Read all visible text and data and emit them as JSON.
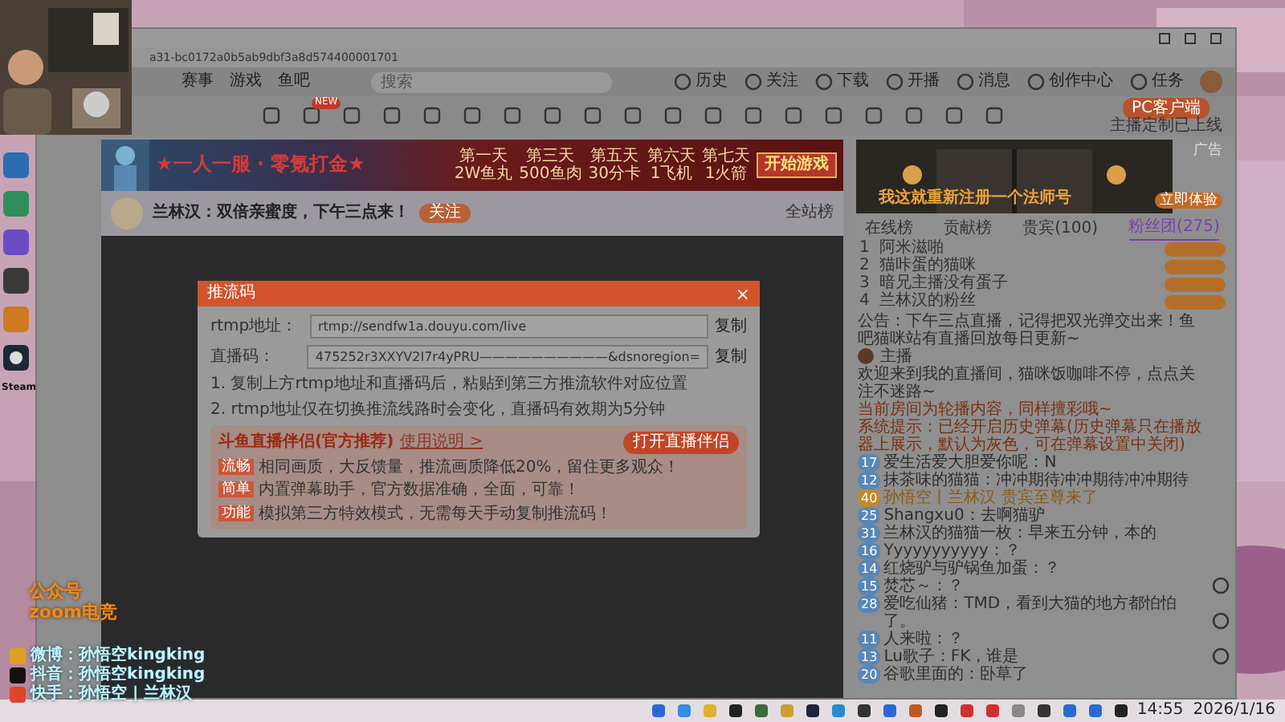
{
  "desktop_icons": [
    {
      "label": "Steam"
    }
  ],
  "browser": {
    "url": "a31-bc0172a0b5ab9dbf3a8d574400001701",
    "nav": [
      "赛事",
      "游戏",
      "鱼吧"
    ],
    "search": {
      "placeholder": "搜索"
    },
    "header_items": [
      {
        "label": "历史"
      },
      {
        "label": "关注"
      },
      {
        "label": "下载"
      },
      {
        "label": "开播"
      },
      {
        "label": "消息"
      },
      {
        "label": "创作中心"
      },
      {
        "label": "任务"
      }
    ],
    "tool_badge": "NEW",
    "pc_client": {
      "label": "PC客户端",
      "note": "主播定制已上线"
    }
  },
  "banner": {
    "slogan": "★一人一服 · 零氪打金★",
    "days": [
      {
        "day": "第一天",
        "reward": "2W鱼丸"
      },
      {
        "day": "第三天",
        "reward": "500鱼肉"
      },
      {
        "day": "第五天",
        "reward": "30分卡"
      },
      {
        "day": "第六天",
        "reward": "1飞机"
      },
      {
        "day": "第七天",
        "reward": "1火箭"
      }
    ],
    "button": "开始游戏"
  },
  "streamer": {
    "title": "兰林汉：双倍亲蜜度，下午三点来！",
    "follow": "关注",
    "rank": "全站榜"
  },
  "modal": {
    "title": "推流码",
    "close": "×",
    "fields": [
      {
        "label": "rtmp地址：",
        "value": "rtmp://sendfw1a.douyu.com/live",
        "copy": "复制"
      },
      {
        "label": "直播码：",
        "value": "475252r3XXYV2I7r4yPRU——————————&dsnoregion=",
        "copy": "复制"
      }
    ],
    "notes": [
      "1. 复制上方rtmp地址和直播码后，粘贴到第三方推流软件对应位置",
      "2. rtmp地址仅在切换推流线路时会变化，直播码有效期为5分钟"
    ],
    "promo": {
      "title": "斗鱼直播伴侣(官方推荐)",
      "link": "使用说明 >",
      "button": "打开直播伴侣",
      "lines": [
        {
          "tag": "流畅",
          "text": "相同画质，大反馈量，推流画质降低20%，留住更多观众！"
        },
        {
          "tag": "简单",
          "text": "内置弹幕助手，官方数据准确，全面，可靠！"
        },
        {
          "tag": "功能",
          "text": "模拟第三方特效模式，无需每天手动复制推流码！"
        }
      ]
    }
  },
  "sidebar": {
    "ad": {
      "label": "广告",
      "caption": "我这就重新注册一个法师号",
      "button": "立即体验"
    },
    "tabs": [
      {
        "label": "在线榜",
        "selected": false
      },
      {
        "label": "贡献榜",
        "selected": false
      },
      {
        "label": "贵宾(100)",
        "selected": false
      },
      {
        "label": "粉丝团(275)",
        "selected": true
      }
    ],
    "ranks": [
      {
        "rank": "1",
        "name": "阿米滋啪"
      },
      {
        "rank": "2",
        "name": "猫咔蛋的猫咪"
      },
      {
        "rank": "3",
        "name": "暗兄主播没有蛋子"
      },
      {
        "rank": "4",
        "name": "兰林汉的粉丝"
      }
    ],
    "notice": "公告：下午三点直播，记得把双光弹交出来！鱼吧猫咪站有直播回放每日更新~",
    "host": {
      "name": "主播",
      "text": "欢迎来到我的直播间，猫咪饭咖啡不停，点点关注不迷路~"
    },
    "chat": [
      {
        "kind": "system",
        "text": "当前房间为轮播内容，同样擅彩哦~"
      },
      {
        "kind": "system",
        "text": "系统提示：已经开启历史弹幕(历史弹幕只在播放器上展示，默认为灰色，可在弹幕设置中关闭)"
      },
      {
        "kind": "message",
        "level": "17",
        "text": "爱生活爱大胆爱你呢：N"
      },
      {
        "kind": "message",
        "level": "12",
        "text": "抹茶味的猫猫：冲冲期待冲冲期待冲冲期待"
      },
      {
        "kind": "entrance",
        "level": "40",
        "text": "孙悟空丨兰林汉 贵宾至尊来了"
      },
      {
        "kind": "message",
        "level": "25",
        "text": "Shangxu0：去啊猫驴"
      },
      {
        "kind": "message",
        "level": "31",
        "text": "兰林汉的猫猫一枚：早来五分钟，本的"
      },
      {
        "kind": "message",
        "level": "16",
        "text": "Yyyyyyyyyyy：？"
      },
      {
        "kind": "message",
        "level": "14",
        "text": "红烧驴与驴锅鱼加蛋：？"
      },
      {
        "kind": "message",
        "level": "15",
        "text": "焚芯～：？"
      },
      {
        "kind": "message",
        "level": "28",
        "text": "爱吃仙猪：TMD，看到大猫的地方都怕怕了。"
      },
      {
        "kind": "message",
        "level": "11",
        "text": "人来啦：？"
      },
      {
        "kind": "message",
        "level": "13",
        "text": "Lu歌子：FK，谁是"
      },
      {
        "kind": "message",
        "level": "20",
        "text": "谷歌里面的：卧草了"
      }
    ]
  },
  "overlay": {
    "lines": [
      "公众号",
      "zoom电竞"
    ],
    "socials": [
      {
        "text": "微博：孙悟空kingking"
      },
      {
        "text": "抖音：孙悟空kingking"
      },
      {
        "text": "快手：孙悟空 | 兰林汉"
      }
    ]
  },
  "taskbar": {
    "time": "14:55",
    "date": "2026/1/16"
  }
}
